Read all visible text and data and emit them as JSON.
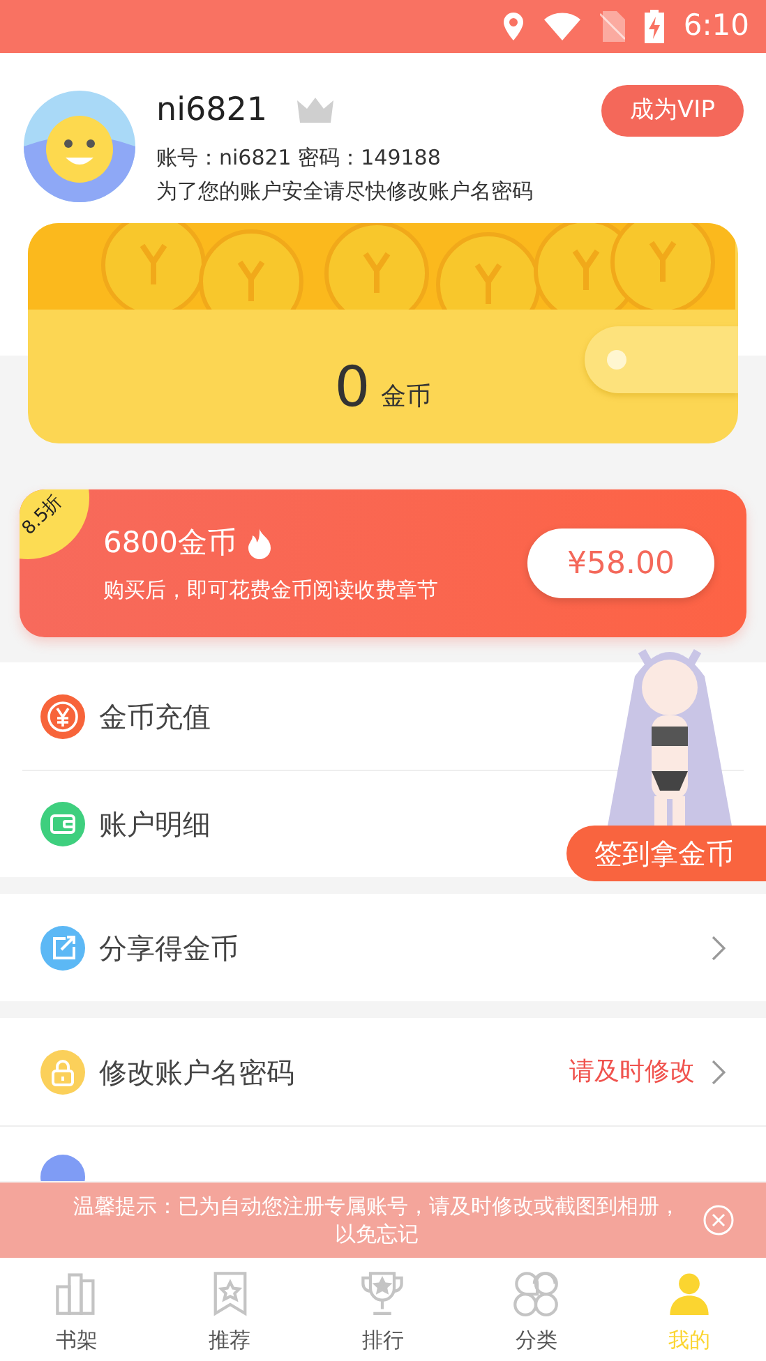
{
  "status_bar": {
    "time": "6:10"
  },
  "profile": {
    "username": "ni6821",
    "vip": false,
    "credentials": "账号：ni6821 密码：149188",
    "notice": "为了您的账户安全请尽快修改账户名密码",
    "vip_button": "成为VIP"
  },
  "wallet": {
    "balance": "0",
    "unit": "金币"
  },
  "promo": {
    "discount": "8.5折",
    "title": "6800金币",
    "subtitle": "购买后，即可花费金币阅读收费章节",
    "price": "¥58.00"
  },
  "menu_groups": [
    [
      {
        "kind": "coin",
        "label": "金币充值",
        "chevron": false
      },
      {
        "kind": "wallet",
        "label": "账户明细",
        "chevron": false
      }
    ],
    [
      {
        "kind": "share",
        "label": "分享得金币",
        "chevron": true
      }
    ],
    [
      {
        "kind": "lock",
        "label": "修改账户名密码",
        "hint": "请及时修改",
        "chevron": true
      },
      {
        "kind": "partial"
      }
    ]
  ],
  "checkin_button": "签到拿金币",
  "toast": {
    "message": "温馨提示：已为自动您注册专属账号，请及时修改或截图到相册，以免忘记"
  },
  "tabs": [
    {
      "kind": "shelf",
      "label": "书架",
      "selected": false
    },
    {
      "kind": "recommend",
      "label": "推荐",
      "selected": false
    },
    {
      "kind": "rank",
      "label": "排行",
      "selected": false
    },
    {
      "kind": "category",
      "label": "分类",
      "selected": false
    },
    {
      "kind": "me",
      "label": "我的",
      "selected": true
    }
  ]
}
